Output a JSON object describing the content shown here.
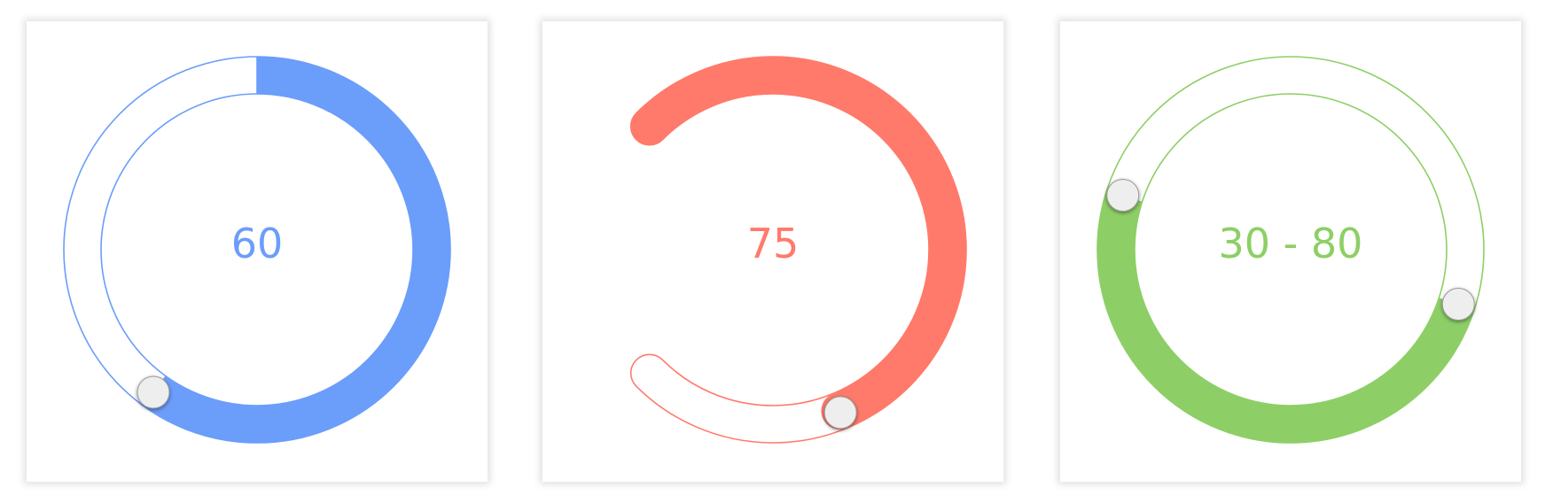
{
  "sliders": [
    {
      "kind": "single",
      "value": 60,
      "display": "60",
      "min": 0,
      "max": 100,
      "start_angle_deg": 270,
      "span_deg": 360,
      "color": "#6b9dfa",
      "has_track_outline": true
    },
    {
      "kind": "single",
      "value": 75,
      "display": "75",
      "min": 0,
      "max": 100,
      "start_angle_deg": 225,
      "span_deg": 270,
      "color": "#ff7a6a",
      "has_track_outline": true,
      "rounded_ends": true
    },
    {
      "kind": "range",
      "low": 30,
      "high": 80,
      "display": "30 - 80",
      "min": 0,
      "max": 100,
      "start_angle_deg": 270,
      "span_deg": 360,
      "color": "#8dcf66",
      "has_track_outline": true
    }
  ],
  "handle_color": "#eeeeee"
}
